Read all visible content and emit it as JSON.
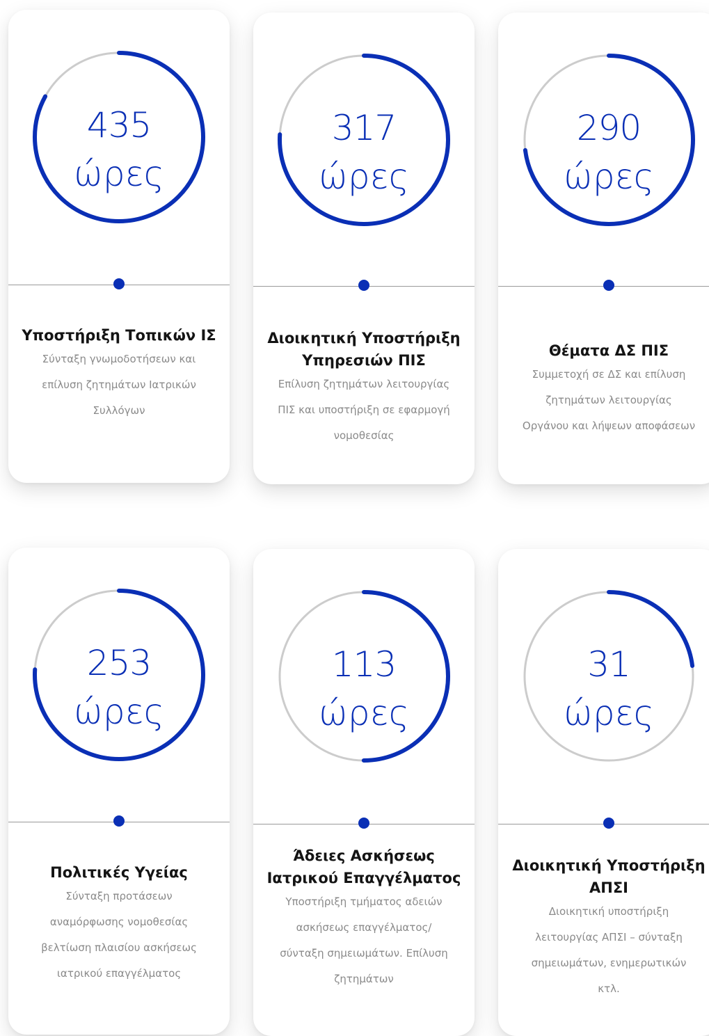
{
  "colors": {
    "accent": "#0a2fb5",
    "track": "#cccccc",
    "title": "#141414",
    "description": "#8a8a8a"
  },
  "cards": [
    {
      "value": "435",
      "unit": "ώρες",
      "progress": 0.83,
      "title": "Υποστήριξη Τοπικών ΙΣ",
      "description": "Σύνταξη γνωμοδοτήσεων και επίλυση ζητημάτων Ιατρικών Συλλόγων"
    },
    {
      "value": "317",
      "unit": "ώρες",
      "progress": 0.76,
      "title": "Διοικητική Υποστήριξη Υπηρεσιών ΠΙΣ",
      "description": "Επίλυση ζητημάτων λειτουργίας ΠΙΣ και υποστήριξη σε εφαρμογή νομοθεσίας"
    },
    {
      "value": "290",
      "unit": "ώρες",
      "progress": 0.73,
      "title": "Θέματα ΔΣ ΠΙΣ",
      "description": "Συμμετοχή σε ΔΣ και επίλυση ζητημάτων λειτουργίας Οργάνου και λήψεων αποφάσεων"
    },
    {
      "value": "253",
      "unit": "ώρες",
      "progress": 0.76,
      "title": "Πολιτικές Υγείας",
      "description": "Σύνταξη προτάσεων αναμόρφωσης νομοθεσίας βελτίωση πλαισίου ασκήσεως ιατρικού επαγγέλματος"
    },
    {
      "value": "113",
      "unit": "ώρες",
      "progress": 0.5,
      "title": "Άδειες Ασκήσεως Ιατρικού Επαγγέλματος",
      "description": "Υποστήριξη τμήματος αδειών ασκήσεως επαγγέλματος/ σύνταξη σημειωμάτων. Επίλυση ζητημάτων"
    },
    {
      "value": "31",
      "unit": "ώρες",
      "progress": 0.23,
      "title": "Διοικητική Υποστήριξη ΑΠΣΙ",
      "description": "Διοικητική υποστήριξη λειτουργίας ΑΠΣΙ – σύνταξη σημειωμάτων, ενημερωτικών κτλ."
    }
  ]
}
